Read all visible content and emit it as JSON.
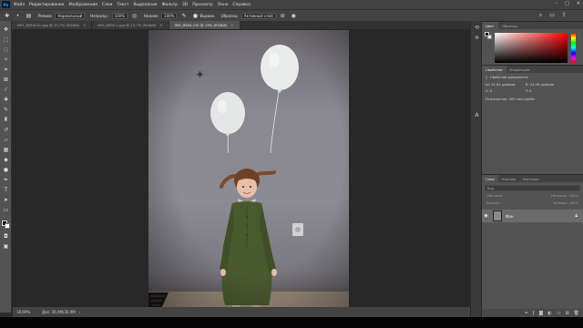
{
  "menu": {
    "logo": "Ps",
    "items": [
      "Файл",
      "Редактирование",
      "Изображение",
      "Слои",
      "Текст",
      "Выделение",
      "Фильтр",
      "3D",
      "Просмотр",
      "Окно",
      "Справка"
    ]
  },
  "options": {
    "mode_label": "Режим:",
    "mode_value": "Нормальный",
    "opacity_label": "Непрозр.:",
    "opacity_value": "100%",
    "flow_label": "Нажим:",
    "flow_value": "100%",
    "aligned_label": "Выравн.",
    "sample_label": "Образец:",
    "sample_value": "Активный слой"
  },
  "tabs": [
    {
      "label": "IMG_8994(31).jpg @ 15,7% (RGB/8)",
      "active": false
    },
    {
      "label": "IMG_8995-1.jpg @ 15,7% (RGB/8)",
      "active": false
    },
    {
      "label": "IMG_8994-СЮ @ 19% (RGB/8)",
      "active": true
    }
  ],
  "status": {
    "zoom": "18,69%",
    "doc": "Док: 36,9М/36,9М"
  },
  "color_panel": {
    "tabs": [
      "Цвет",
      "Образцы"
    ]
  },
  "properties_panel": {
    "tabs": [
      "Свойства",
      "Коррекция"
    ],
    "title": "Свойства документа",
    "w_label": "Ш:",
    "w_value": "51,84 дюймов",
    "h_label": "В:",
    "h_value": "34,56 дюймов",
    "x_label": "X:",
    "x_value": "0",
    "y_label": "Y:",
    "y_value": "0",
    "resolution": "Разрешение: 300 пикс/дюйм"
  },
  "layers_panel": {
    "tabs": [
      "Слои",
      "Каналы",
      "Контуры"
    ],
    "kind": "Вид",
    "blend": "Обычные",
    "opacity": "Непрозр.: 100%",
    "lock": "Закреп.:",
    "fill": "Заливка: 100%",
    "layer_name": "Фон"
  },
  "colors": {
    "accent": "#31a8ff",
    "panel": "#535353",
    "background": "#2b2b2b"
  }
}
